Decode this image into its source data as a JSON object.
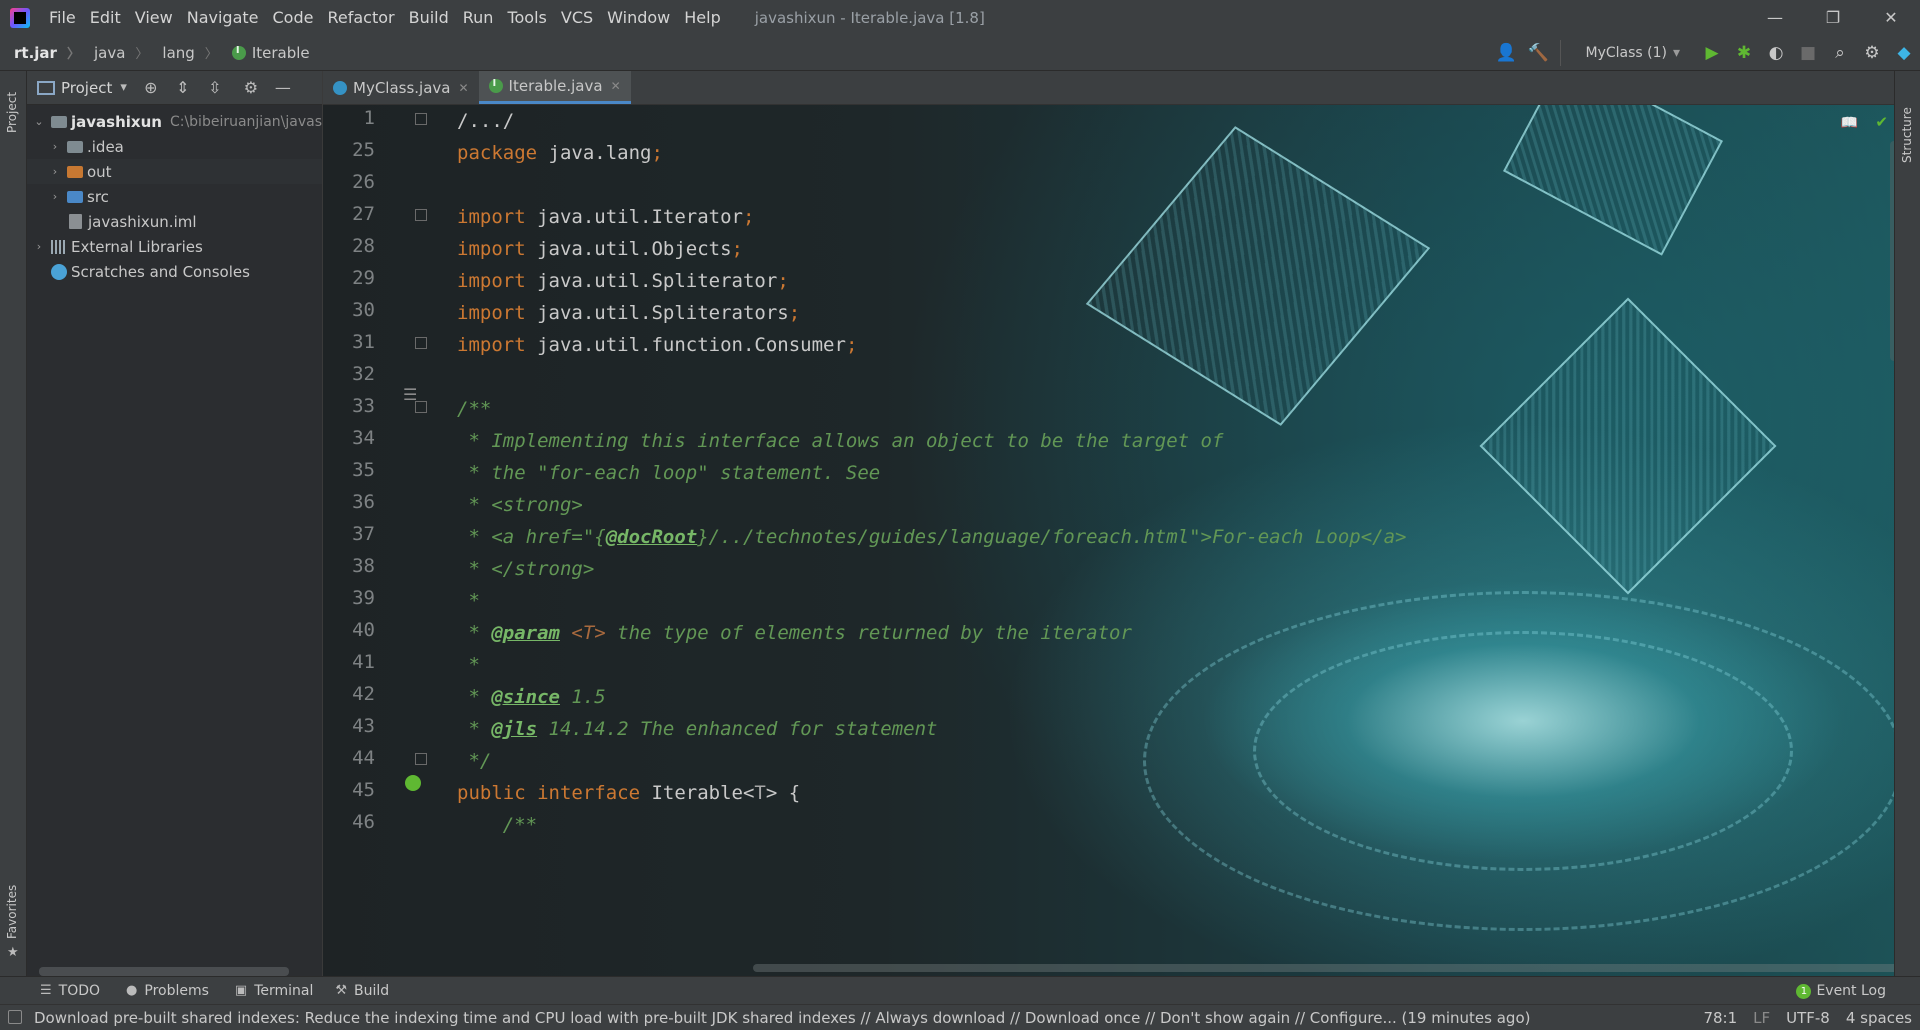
{
  "window": {
    "title": "javashixun - Iterable.java [1.8]",
    "menu": [
      "File",
      "Edit",
      "View",
      "Navigate",
      "Code",
      "Refactor",
      "Build",
      "Run",
      "Tools",
      "VCS",
      "Window",
      "Help"
    ],
    "minimize": "—",
    "restore": "❐",
    "close": "✕"
  },
  "breadcrumb": [
    "rt.jar",
    "java",
    "lang",
    "Iterable"
  ],
  "toolbar": {
    "run_config": "MyClass (1)",
    "run_config_caret": "▾"
  },
  "left_strip": {
    "project": "Project",
    "favorites": "Favorites",
    "star": "★"
  },
  "right_strip": {
    "structure": "Structure"
  },
  "project_panel": {
    "title": "Project",
    "caret": "▾",
    "tree": [
      {
        "label": "javashixun",
        "note": "C:\\bibeiruanjian\\javas",
        "chev": "⌄"
      },
      {
        "label": ".idea",
        "chev": "›"
      },
      {
        "label": "out",
        "chev": "›"
      },
      {
        "label": "src",
        "chev": "›"
      },
      {
        "label": "javashixun.iml"
      },
      {
        "label": "External Libraries",
        "chev": "›"
      },
      {
        "label": "Scratches and Consoles"
      }
    ]
  },
  "tabs": [
    {
      "label": "MyClass.java",
      "close": "✕"
    },
    {
      "label": "Iterable.java",
      "close": "✕"
    }
  ],
  "editor": {
    "line_numbers": [
      "1",
      "25",
      "26",
      "27",
      "28",
      "29",
      "30",
      "31",
      "32",
      "33",
      "34",
      "35",
      "36",
      "37",
      "38",
      "39",
      "40",
      "41",
      "42",
      "43",
      "44",
      "45",
      "46"
    ],
    "lines": {
      "l1": "/.../",
      "l25_kw": "package",
      "l25_pl": " java.lang",
      "semi": ";",
      "import": "import",
      "i27": " java.util.Iterator",
      "i28": " java.util.Objects",
      "i29": " java.util.Spliterator",
      "i30": " java.util.Spliterators",
      "i31": " java.util.function.Consumer",
      "l33": "/**",
      "l34": " * Implementing this interface allows an object to be the target of",
      "l35": " * the \"for-each loop\" statement. See",
      "l36": " * <strong>",
      "l37a": " * <a href=\"{",
      "l37tag": "@docRoot",
      "l37b": "}/../technotes/guides/language/foreach.html\">For-each Loop</a>",
      "l38": " * </strong>",
      "l39": " *",
      "l40a": " * ",
      "l40tag": "@param",
      "l40gen": " <T>",
      "l40b": " the type of elements returned by the iterator",
      "l41": " *",
      "l42a": " * ",
      "l42tag": "@since",
      "l42b": " 1.5",
      "l43a": " * ",
      "l43tag": "@jls",
      "l43b": " 14.14.2 The enhanced for statement",
      "l44": " */",
      "l45_kw1": "public",
      "l45_kw2": " interface",
      "l45_pl": " Iterable<",
      "l45_t": "T",
      "l45_end": "> {",
      "l46": "    /**"
    }
  },
  "bottom_tools": [
    {
      "label": "TODO",
      "icon": "☰"
    },
    {
      "label": "Problems",
      "icon": "●"
    },
    {
      "label": "Terminal",
      "icon": "▣"
    },
    {
      "label": "Build",
      "icon": "⚒"
    }
  ],
  "event_log": {
    "badge": "1",
    "label": "Event Log"
  },
  "status": {
    "message": "Download pre-built shared indexes: Reduce the indexing time and CPU load with pre-built JDK shared indexes // Always download // Download once // Don't show again // Configure... (19 minutes ago)",
    "position": "78:1",
    "line_sep": "LF",
    "encoding": "UTF-8",
    "indent": "4 spaces"
  }
}
